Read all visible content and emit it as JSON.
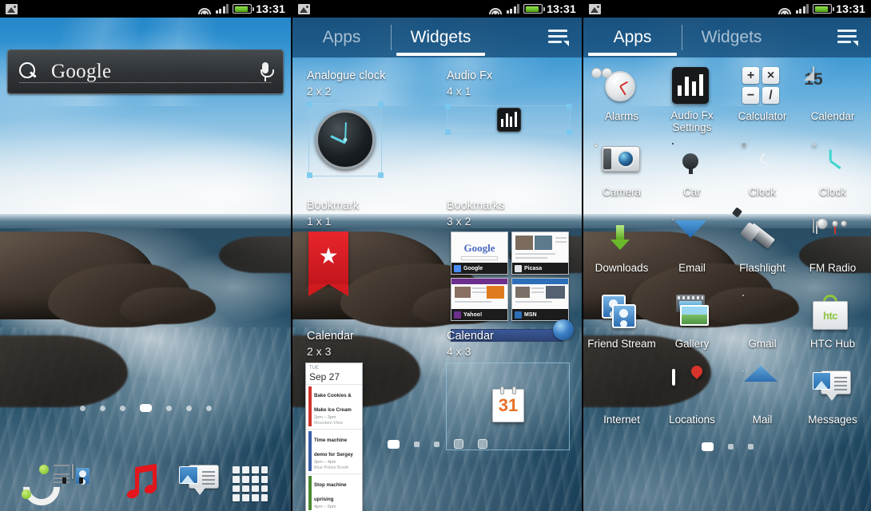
{
  "status_bar": {
    "photo_icon": "photo-icon",
    "wifi_icon": "wifi-icon",
    "signal_icon": "signal-icon",
    "battery_icon": "battery-icon",
    "time": "13:31"
  },
  "home_screen": {
    "search_widget": {
      "label": "Google",
      "search_icon": "search-icon",
      "mic_icon": "microphone-icon"
    },
    "page_indicator": {
      "count": 7,
      "active_index": 3
    },
    "dock": [
      {
        "name": "phone",
        "icon": "phone-icon"
      },
      {
        "name": "people",
        "icon": "contacts-icon"
      },
      {
        "name": "music",
        "icon": "music-note-icon"
      },
      {
        "name": "messages",
        "icon": "messages-icon"
      },
      {
        "name": "all-apps",
        "icon": "app-grid-icon"
      }
    ]
  },
  "widgets_screen": {
    "tabs": [
      {
        "label": "Apps",
        "active": false
      },
      {
        "label": "Widgets",
        "active": true
      }
    ],
    "menu_icon": "menu-list-icon",
    "page_indicator": {
      "count": 5,
      "active_index": 0
    },
    "widgets": [
      {
        "name": "Analogue clock",
        "size": "2 x 2"
      },
      {
        "name": "Audio Fx",
        "size": "4 x 1"
      },
      {
        "name": "Bookmark",
        "size": "1 x 1"
      },
      {
        "name": "Bookmarks",
        "size": "3 x 2"
      },
      {
        "name": "Calendar",
        "size": "2 x 3"
      },
      {
        "name": "Calendar",
        "size": "4 x 3"
      }
    ],
    "bookmarks_preview": [
      {
        "title": "Google"
      },
      {
        "title": "Picasa"
      },
      {
        "title": "Yahoo!"
      },
      {
        "title": "MSN"
      }
    ],
    "calendar_preview": {
      "day_of_week": "TUE",
      "date": "Sep 27",
      "events": [
        {
          "title": "Bake Cookies & Make Ice Cream",
          "time": "2pm – 3pm",
          "location": "Mountain View",
          "color": "#d0342c"
        },
        {
          "title": "Time machine demo for Sergey",
          "time": "3pm – 4pm",
          "location": "Blue Police Booth",
          "color": "#3b5fa8"
        },
        {
          "title": "Stop machine uprising",
          "time": "4pm – 5pm",
          "location": "",
          "color": "#4a8a32"
        }
      ]
    },
    "calendar_large_preview": {
      "date_number": "31"
    }
  },
  "apps_screen": {
    "tabs": [
      {
        "label": "Apps",
        "active": true
      },
      {
        "label": "Widgets",
        "active": false
      }
    ],
    "menu_icon": "menu-list-icon",
    "page_indicator": {
      "count": 3,
      "active_index": 0
    },
    "apps": [
      {
        "label": "Alarms",
        "icon": "alarm-clock-icon"
      },
      {
        "label": "Audio Fx Settings",
        "icon": "equalizer-icon"
      },
      {
        "label": "Calculator",
        "icon": "calculator-icon"
      },
      {
        "label": "Calendar",
        "icon": "calendar-icon"
      },
      {
        "label": "Camera",
        "icon": "camera-icon"
      },
      {
        "label": "Car",
        "icon": "steering-wheel-icon"
      },
      {
        "label": "Clock",
        "icon": "clock-dark-icon"
      },
      {
        "label": "Clock",
        "icon": "clock-teal-icon"
      },
      {
        "label": "Downloads",
        "icon": "download-arrow-icon"
      },
      {
        "label": "Email",
        "icon": "email-envelope-icon"
      },
      {
        "label": "Flashlight",
        "icon": "flashlight-icon"
      },
      {
        "label": "FM Radio",
        "icon": "fm-radio-icon"
      },
      {
        "label": "Friend Stream",
        "icon": "friend-stream-icon"
      },
      {
        "label": "Gallery",
        "icon": "gallery-icon"
      },
      {
        "label": "Gmail",
        "icon": "gmail-icon"
      },
      {
        "label": "HTC Hub",
        "icon": "htc-hub-icon"
      },
      {
        "label": "Internet",
        "icon": "globe-icon"
      },
      {
        "label": "Locations",
        "icon": "map-pin-icon"
      },
      {
        "label": "Mail",
        "icon": "mail-open-icon"
      },
      {
        "label": "Messages",
        "icon": "messages-icon"
      }
    ],
    "calculator_keys": [
      "+",
      "×",
      "−",
      "/"
    ],
    "calendar_icon_number": "15",
    "htc_hub_text": "htc",
    "fm_radio_text": "FM"
  }
}
